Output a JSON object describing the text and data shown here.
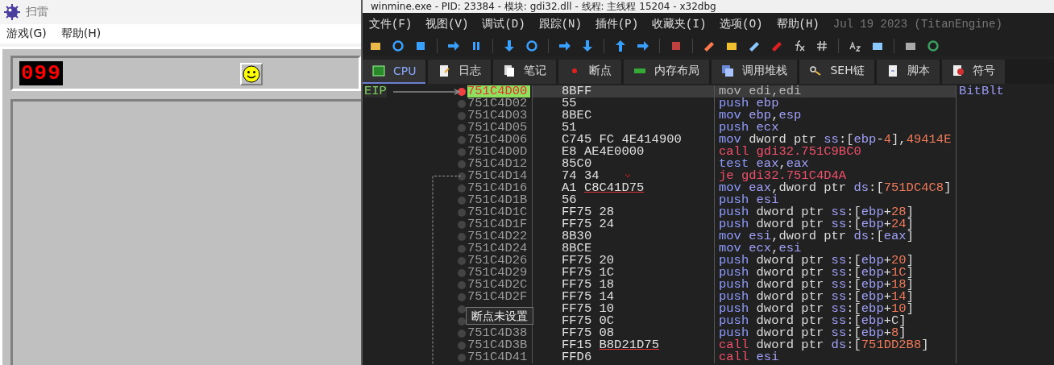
{
  "minesweeper": {
    "title": "扫雷",
    "menu": [
      "游戏(G)",
      "帮助(H)"
    ],
    "mine_counter": "099"
  },
  "debugger": {
    "title": "winmine.exe - PID: 23384 - 模块: gdi32.dll - 线程: 主线程 15204 - x32dbg",
    "menu": [
      "文件(F)",
      "视图(V)",
      "调试(D)",
      "跟踪(N)",
      "插件(P)",
      "收藏夹(I)",
      "选项(O)",
      "帮助(H)"
    ],
    "build_info": "Jul 19 2023 (TitanEngine)",
    "tabs": [
      {
        "label": "CPU",
        "selected": true
      },
      {
        "label": "日志",
        "selected": false
      },
      {
        "label": "笔记",
        "selected": false
      },
      {
        "label": "断点",
        "selected": false
      },
      {
        "label": "内存布局",
        "selected": false
      },
      {
        "label": "调用堆栈",
        "selected": false
      },
      {
        "label": "SEH链",
        "selected": false
      },
      {
        "label": "脚本",
        "selected": false
      },
      {
        "label": "符号",
        "selected": false
      }
    ],
    "eip_label": "EIP",
    "rows": [
      {
        "address": "751C4D00",
        "bytes": "8BFF",
        "instruction": "mov edi,edi",
        "kind": "plain",
        "selected": true,
        "breakpoint": true,
        "comment": "BitBlt"
      },
      {
        "address": "751C4D02",
        "bytes": "55",
        "instruction": "push ebp",
        "kind": "plain",
        "selected": false,
        "breakpoint": false
      },
      {
        "address": "751C4D03",
        "bytes": "8BEC",
        "instruction": "mov ebp,esp",
        "kind": "plain",
        "selected": false,
        "breakpoint": false
      },
      {
        "address": "751C4D05",
        "bytes": "51",
        "instruction": "push ecx",
        "kind": "plain",
        "selected": false,
        "breakpoint": false
      },
      {
        "address": "751C4D06",
        "bytes": "C745 FC 4E414900",
        "instruction": "mov dword ptr ss:[ebp-4],49414E",
        "kind": "plain",
        "selected": false,
        "breakpoint": false
      },
      {
        "address": "751C4D0D",
        "bytes": "E8 AE4E0000",
        "instruction": "call gdi32.751C9BC0",
        "kind": "call",
        "selected": false,
        "breakpoint": false
      },
      {
        "address": "751C4D12",
        "bytes": "85C0",
        "instruction": "test eax,eax",
        "kind": "plain",
        "selected": false,
        "breakpoint": false
      },
      {
        "address": "751C4D14",
        "bytes": "74 34",
        "instruction": "je gdi32.751C4D4A",
        "kind": "jump",
        "selected": false,
        "breakpoint": false
      },
      {
        "address": "751C4D16",
        "bytes": "A1",
        "bytes_ref": "C8C41D75",
        "instruction": "mov eax,dword ptr ds:[751DC4C8]",
        "kind": "plain",
        "selected": false,
        "breakpoint": false
      },
      {
        "address": "751C4D1B",
        "bytes": "56",
        "instruction": "push esi",
        "kind": "plain",
        "selected": false,
        "breakpoint": false
      },
      {
        "address": "751C4D1C",
        "bytes": "FF75 28",
        "instruction": "push dword ptr ss:[ebp+28]",
        "kind": "plain",
        "selected": false,
        "breakpoint": false
      },
      {
        "address": "751C4D1F",
        "bytes": "FF75 24",
        "instruction": "push dword ptr ss:[ebp+24]",
        "kind": "plain",
        "selected": false,
        "breakpoint": false
      },
      {
        "address": "751C4D22",
        "bytes": "8B30",
        "instruction": "mov esi,dword ptr ds:[eax]",
        "kind": "plain",
        "selected": false,
        "breakpoint": false
      },
      {
        "address": "751C4D24",
        "bytes": "8BCE",
        "instruction": "mov ecx,esi",
        "kind": "plain",
        "selected": false,
        "breakpoint": false
      },
      {
        "address": "751C4D26",
        "bytes": "FF75 20",
        "instruction": "push dword ptr ss:[ebp+20]",
        "kind": "plain",
        "selected": false,
        "breakpoint": false
      },
      {
        "address": "751C4D29",
        "bytes": "FF75 1C",
        "instruction": "push dword ptr ss:[ebp+1C]",
        "kind": "plain",
        "selected": false,
        "breakpoint": false
      },
      {
        "address": "751C4D2C",
        "bytes": "FF75 18",
        "instruction": "push dword ptr ss:[ebp+18]",
        "kind": "plain",
        "selected": false,
        "breakpoint": false
      },
      {
        "address": "751C4D2F",
        "bytes": "FF75 14",
        "instruction": "push dword ptr ss:[ebp+14]",
        "kind": "plain",
        "selected": false,
        "breakpoint": false
      },
      {
        "bytes": "FF75 10",
        "instruction": "push dword ptr ss:[ebp+10]",
        "kind": "plain",
        "selected": false,
        "breakpoint": false
      },
      {
        "bytes": "FF75 0C",
        "instruction": "push dword ptr ss:[ebp+C]",
        "kind": "plain",
        "selected": false,
        "breakpoint": false
      },
      {
        "address": "751C4D38",
        "bytes": "FF75 08",
        "instruction": "push dword ptr ss:[ebp+8]",
        "kind": "plain",
        "selected": false,
        "breakpoint": false
      },
      {
        "address": "751C4D3B",
        "bytes": "FF15",
        "bytes_ref": "B8D21D75",
        "instruction": "call dword ptr ds:[751DD2B8]",
        "kind": "call",
        "selected": false,
        "breakpoint": false
      },
      {
        "address": "751C4D41",
        "bytes": "FFD6",
        "instruction": "call esi",
        "kind": "call",
        "selected": false,
        "breakpoint": false
      }
    ],
    "tooltip": "断点未设置"
  }
}
